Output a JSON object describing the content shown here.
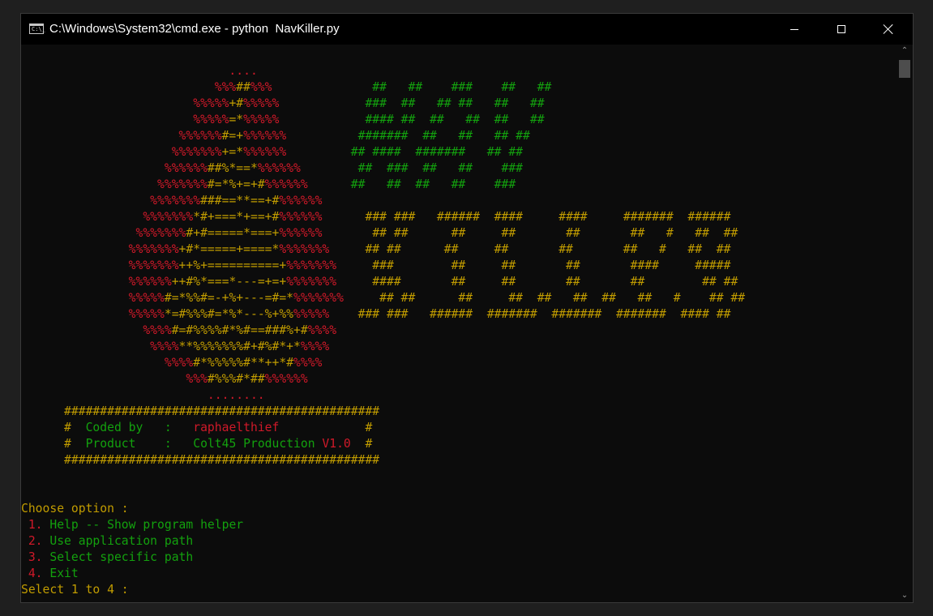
{
  "window": {
    "title": "C:\\Windows\\System32\\cmd.exe - python  NavKiller.py",
    "icon_text": "C:\\_"
  },
  "colors": {
    "background": "#0c0c0c",
    "red": "#d01929",
    "yellow": "#c19c00",
    "green": "#13a10e"
  },
  "icons": {
    "app": "cmd-icon",
    "minimize": "minimize-icon",
    "maximize": "maximize-icon",
    "close": "close-icon",
    "scroll_up": "chevron-up-icon",
    "scroll_down": "chevron-down-icon"
  },
  "console": {
    "lines": [
      [
        {
          "t": "                             ....",
          "c": "r"
        }
      ],
      [
        {
          "t": "                           %%%",
          "c": "r"
        },
        {
          "t": "##",
          "c": "y"
        },
        {
          "t": "%%%",
          "c": "r"
        },
        {
          "t": "              ",
          "c": ""
        },
        {
          "t": "##   ##    ###    ##   ##",
          "c": "g"
        }
      ],
      [
        {
          "t": "                        %%%%%",
          "c": "r"
        },
        {
          "t": "+#",
          "c": "y"
        },
        {
          "t": "%%%%%",
          "c": "r"
        },
        {
          "t": "            ",
          "c": ""
        },
        {
          "t": "###  ##   ## ##   ##   ##",
          "c": "g"
        }
      ],
      [
        {
          "t": "                        %%%%%",
          "c": "r"
        },
        {
          "t": "=*",
          "c": "y"
        },
        {
          "t": "%%%%%",
          "c": "r"
        },
        {
          "t": "            ",
          "c": ""
        },
        {
          "t": "#### ##  ##   ##  ##   ##",
          "c": "g"
        }
      ],
      [
        {
          "t": "                      %%%%%%",
          "c": "r"
        },
        {
          "t": "#=+",
          "c": "y"
        },
        {
          "t": "%%%%%%",
          "c": "r"
        },
        {
          "t": "          ",
          "c": ""
        },
        {
          "t": "#######  ##   ##   ## ##",
          "c": "g"
        }
      ],
      [
        {
          "t": "                     %%%%%%%",
          "c": "r"
        },
        {
          "t": "+=*",
          "c": "y"
        },
        {
          "t": "%%%%%%",
          "c": "r"
        },
        {
          "t": "         ",
          "c": ""
        },
        {
          "t": "## ####  #######   ## ##",
          "c": "g"
        }
      ],
      [
        {
          "t": "                    %%%%%%",
          "c": "r"
        },
        {
          "t": "##%*==*",
          "c": "y"
        },
        {
          "t": "%%%%%%",
          "c": "r"
        },
        {
          "t": "        ",
          "c": ""
        },
        {
          "t": "##  ###  ##   ##    ###",
          "c": "g"
        }
      ],
      [
        {
          "t": "                   %%%%%%%",
          "c": "r"
        },
        {
          "t": "#=*%+=+#",
          "c": "y"
        },
        {
          "t": "%%%%%%",
          "c": "r"
        },
        {
          "t": "      ",
          "c": ""
        },
        {
          "t": "##   ##  ##   ##    ###",
          "c": "g"
        }
      ],
      [
        {
          "t": "                  %%%%%%%",
          "c": "r"
        },
        {
          "t": "###==**==+#",
          "c": "y"
        },
        {
          "t": "%%%%%%",
          "c": "r"
        }
      ],
      [
        {
          "t": "                 %%%%%%%",
          "c": "r"
        },
        {
          "t": "*#+===*+==+#",
          "c": "y"
        },
        {
          "t": "%%%%%%",
          "c": "r"
        },
        {
          "t": "      ",
          "c": ""
        },
        {
          "t": "### ###   ######  ####     ####     #######  ######",
          "c": "y"
        }
      ],
      [
        {
          "t": "                %%%%%%%",
          "c": "r"
        },
        {
          "t": "#+#=====*===+",
          "c": "y"
        },
        {
          "t": "%%%%%%",
          "c": "r"
        },
        {
          "t": "      ",
          "c": ""
        },
        {
          "t": " ## ##      ##     ##       ##       ##   #   ##  ##",
          "c": "y"
        }
      ],
      [
        {
          "t": "               %%%%%%%",
          "c": "r"
        },
        {
          "t": "+#*=====+====*",
          "c": "y"
        },
        {
          "t": "%%%%%%%",
          "c": "r"
        },
        {
          "t": "    ",
          "c": ""
        },
        {
          "t": " ## ##      ##     ##       ##       ##   #   ##  ##",
          "c": "y"
        }
      ],
      [
        {
          "t": "               %%%%%%%",
          "c": "r"
        },
        {
          "t": "++%+==========+",
          "c": "y"
        },
        {
          "t": "%%%%%%%",
          "c": "r"
        },
        {
          "t": "    ",
          "c": ""
        },
        {
          "t": " ###        ##     ##       ##       ####     #####",
          "c": "y"
        }
      ],
      [
        {
          "t": "               %%%%%%",
          "c": "r"
        },
        {
          "t": "++#%*===*---=+=+",
          "c": "y"
        },
        {
          "t": "%%%%%%%",
          "c": "r"
        },
        {
          "t": "    ",
          "c": ""
        },
        {
          "t": " ####       ##     ##       ##       ##        ## ##",
          "c": "y"
        }
      ],
      [
        {
          "t": "               %%%%%",
          "c": "r"
        },
        {
          "t": "#=*%%#=-+%+---=#=*",
          "c": "y"
        },
        {
          "t": "%%%%%%%",
          "c": "r"
        },
        {
          "t": "    ",
          "c": ""
        },
        {
          "t": " ## ##      ##     ##  ##   ##  ##   ##   #    ## ##",
          "c": "y"
        }
      ],
      [
        {
          "t": "               %%%%%",
          "c": "r"
        },
        {
          "t": "*=#%%%#=*%*---%+%%",
          "c": "y"
        },
        {
          "t": "%%%%%",
          "c": "r"
        },
        {
          "t": "    ",
          "c": ""
        },
        {
          "t": "### ###   ######  #######  #######  #######  #### ##",
          "c": "y"
        }
      ],
      [
        {
          "t": "                 %%%%",
          "c": "r"
        },
        {
          "t": "#=#%%%%#*%#==###%+#",
          "c": "y"
        },
        {
          "t": "%%%%",
          "c": "r"
        }
      ],
      [
        {
          "t": "                  %%%%",
          "c": "r"
        },
        {
          "t": "**%%%%%%%#+#%#*+*",
          "c": "y"
        },
        {
          "t": "%%%%",
          "c": "r"
        }
      ],
      [
        {
          "t": "                    %%%%",
          "c": "r"
        },
        {
          "t": "#*%%%%%#**++*#",
          "c": "y"
        },
        {
          "t": "%%%%",
          "c": "r"
        }
      ],
      [
        {
          "t": "                       %%%",
          "c": "r"
        },
        {
          "t": "#%%%#*##",
          "c": "y"
        },
        {
          "t": "%%%%%%",
          "c": "r"
        }
      ],
      [
        {
          "t": "                          ........",
          "c": "r"
        }
      ],
      [
        {
          "t": "      ############################################",
          "c": "y"
        }
      ],
      [
        {
          "t": "      #  ",
          "c": "y"
        },
        {
          "t": "Coded by   :   ",
          "c": "g"
        },
        {
          "t": "raphaelthief",
          "c": "r"
        },
        {
          "t": "            #",
          "c": "y"
        }
      ],
      [
        {
          "t": "      #  ",
          "c": "y"
        },
        {
          "t": "Product    :   ",
          "c": "g"
        },
        {
          "t": "Colt45 Production",
          "c": "g"
        },
        {
          "t": " V1.0",
          "c": "r"
        },
        {
          "t": "  #",
          "c": "y"
        }
      ],
      [
        {
          "t": "      ############################################",
          "c": "y"
        }
      ],
      [
        {
          "t": "",
          "c": ""
        }
      ],
      [
        {
          "t": "",
          "c": ""
        }
      ],
      [
        {
          "t": "Choose option :",
          "c": "y"
        }
      ],
      [
        {
          "t": " 1.",
          "c": "r"
        },
        {
          "t": " Help -- Show program helper",
          "c": "g"
        }
      ],
      [
        {
          "t": " 2.",
          "c": "r"
        },
        {
          "t": " Use application path",
          "c": "g"
        }
      ],
      [
        {
          "t": " 3.",
          "c": "r"
        },
        {
          "t": " Select specific path",
          "c": "g"
        }
      ],
      [
        {
          "t": " 4.",
          "c": "r"
        },
        {
          "t": " Exit",
          "c": "g"
        }
      ],
      [
        {
          "t": "Select 1 to 4 :",
          "c": "y"
        }
      ]
    ]
  }
}
